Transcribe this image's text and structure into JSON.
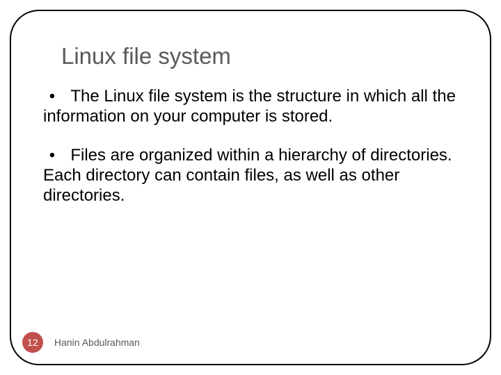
{
  "slide": {
    "title": "Linux file system",
    "bullets": [
      "The Linux file system is the structure in which all the information on your computer is stored.",
      "Files are organized within a hierarchy of directories. Each directory can contain files, as well as other directories."
    ],
    "page_number": "12",
    "author": "Hanin Abdulrahman"
  }
}
